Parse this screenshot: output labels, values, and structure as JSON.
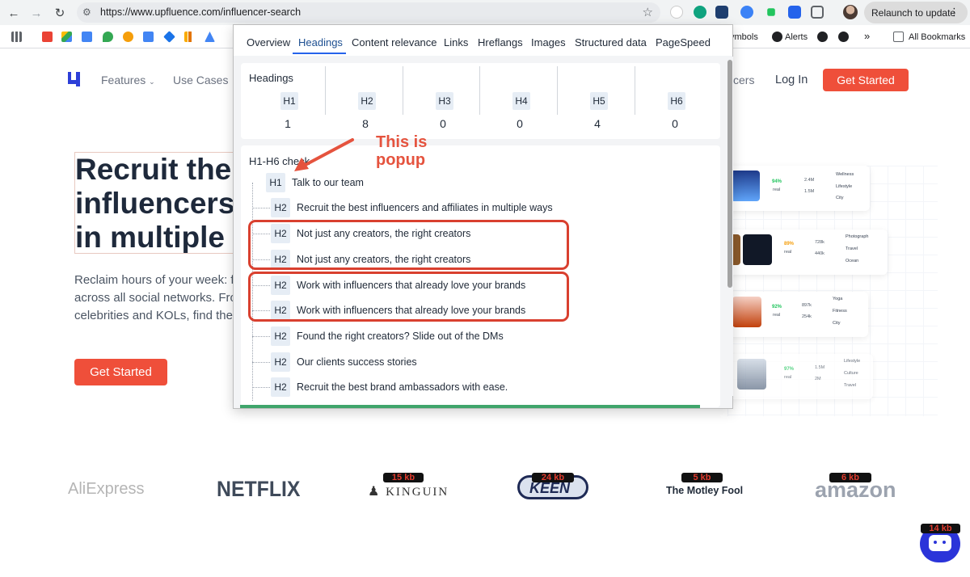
{
  "browser": {
    "url": "https://www.upfluence.com/influencer-search",
    "relaunch_label": "Relaunch to update",
    "bookmarks": [
      {
        "label": "ymbols"
      },
      {
        "label": "Alerts"
      },
      {
        "label": "All Bookmarks"
      }
    ],
    "more_symbol": "»"
  },
  "site": {
    "nav": {
      "features": "Features",
      "use_cases": "Use Cases",
      "influencers_partial": "cers",
      "login": "Log In",
      "get_started": "Get Started"
    },
    "hero": {
      "title_lines": [
        "Recruit the b",
        "influencers a",
        "in multiple w"
      ],
      "sub_lines": [
        "Reclaim hours of your week: f",
        "across all social networks. Fro",
        "celebrities and KOLs, find the"
      ],
      "cta": "Get Started"
    },
    "cards": [
      {
        "pct": "94%",
        "pct_label": "real",
        "stat1": "2.4M",
        "stat2": "1.5M",
        "tags": [
          "Wellness",
          "Lifestyle",
          "City"
        ]
      },
      {
        "pct": "89%",
        "pct_label": "real",
        "stat1": "728k",
        "stat2": "440k",
        "tags": [
          "Photograph",
          "Travel",
          "Ocean"
        ]
      },
      {
        "pct": "92%",
        "pct_label": "real",
        "stat1": "897k",
        "stat2": "254k",
        "tags": [
          "Yoga",
          "Fitness",
          "City"
        ]
      },
      {
        "pct": "97%",
        "pct_label": "real",
        "stat1": "1.5M",
        "stat2": "2M",
        "tags": [
          "Lifestyle",
          "Culture",
          "Travel"
        ]
      }
    ],
    "logos": [
      {
        "name": "AliExpress"
      },
      {
        "name": "NETFLIX"
      },
      {
        "name": "KINGUIN",
        "size": "15 kb"
      },
      {
        "name": "KEEN",
        "size": "24 kb"
      },
      {
        "name": "The Motley Fool",
        "size": "5 kb"
      },
      {
        "name": "amazon",
        "size": "6 kb"
      }
    ],
    "chat_size": "14 kb"
  },
  "popup": {
    "tabs": [
      "Overview",
      "Headings",
      "Content relevance",
      "Links",
      "Hreflangs",
      "Images",
      "Structured data",
      "PageSpeed"
    ],
    "active_tab": "Headings",
    "headings_title": "Headings",
    "heading_counts": [
      {
        "level": "H1",
        "count": "1"
      },
      {
        "level": "H2",
        "count": "8"
      },
      {
        "level": "H3",
        "count": "0"
      },
      {
        "level": "H4",
        "count": "0"
      },
      {
        "level": "H5",
        "count": "4"
      },
      {
        "level": "H6",
        "count": "0"
      }
    ],
    "check_title": "H1-H6 check",
    "tree": [
      {
        "level": "H1",
        "text": "Talk to our team"
      },
      {
        "level": "H2",
        "text": "Recruit the best influencers and affiliates in multiple ways"
      },
      {
        "level": "H2",
        "text": "Not just any creators, the right creators"
      },
      {
        "level": "H2",
        "text": "Not just any creators, the right creators"
      },
      {
        "level": "H2",
        "text": "Work with influencers that already love your brands"
      },
      {
        "level": "H2",
        "text": "Work with influencers that already love your brands"
      },
      {
        "level": "H2",
        "text": "Found the right creators? Slide out of the DMs"
      },
      {
        "level": "H2",
        "text": "Our clients success stories"
      },
      {
        "level": "H2",
        "text": "Recruit the best  brand ambassadors with ease."
      }
    ],
    "annotation": [
      "This is",
      "popup"
    ]
  },
  "colors": {
    "accent": "#ef4f3a",
    "tab_active": "#1d4f91",
    "annotation": "#e5533e",
    "progress": "#3fa56b"
  }
}
